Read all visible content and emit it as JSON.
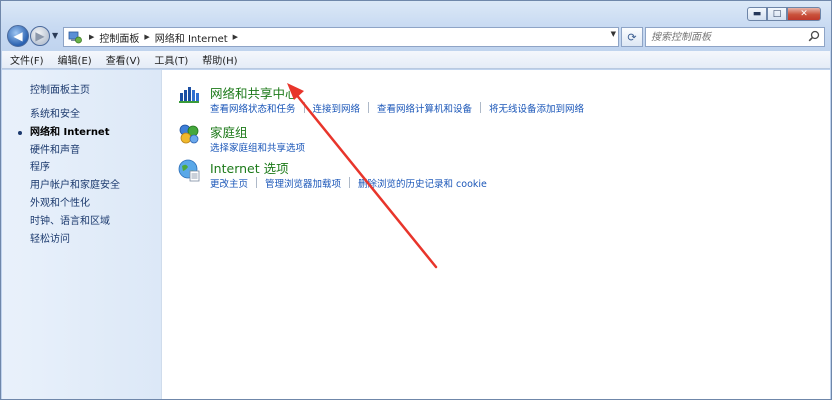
{
  "window": {
    "caption_buttons": {
      "minimize": "▬",
      "maximize": "□",
      "close": "✕"
    }
  },
  "nav": {
    "back_glyph": "◀",
    "forward_glyph": "▶",
    "history_glyph": "▼",
    "address": {
      "crumb_sep": "▶",
      "crumbs": [
        "控制面板",
        "网络和 Internet"
      ],
      "drop_glyph": "▼"
    },
    "refresh_glyph": "⟳",
    "search": {
      "placeholder": "搜索控制面板"
    }
  },
  "menubar": {
    "items": [
      "文件(F)",
      "编辑(E)",
      "查看(V)",
      "工具(T)",
      "帮助(H)"
    ]
  },
  "sidebar": {
    "home": "控制面板主页",
    "items": [
      {
        "label": "系统和安全",
        "active": false
      },
      {
        "label": "网络和 Internet",
        "active": true
      },
      {
        "label": "硬件和声音",
        "active": false
      },
      {
        "label": "程序",
        "active": false
      },
      {
        "label": "用户帐户和家庭安全",
        "active": false
      },
      {
        "label": "外观和个性化",
        "active": false
      },
      {
        "label": "时钟、语言和区域",
        "active": false
      },
      {
        "label": "轻松访问",
        "active": false
      }
    ]
  },
  "categories": [
    {
      "icon": "network-sharing-icon",
      "title": "网络和共享中心",
      "links": [
        "查看网络状态和任务",
        "连接到网络",
        "查看网络计算机和设备",
        "将无线设备添加到网络"
      ]
    },
    {
      "icon": "homegroup-icon",
      "title": "家庭组",
      "links": [
        "选择家庭组和共享选项"
      ]
    },
    {
      "icon": "internet-options-icon",
      "title": "Internet 选项",
      "links": [
        "更改主页",
        "管理浏览器加载项",
        "删除浏览的历史记录和 cookie"
      ]
    }
  ],
  "annotation": {
    "arrow_color": "#e8352b"
  }
}
